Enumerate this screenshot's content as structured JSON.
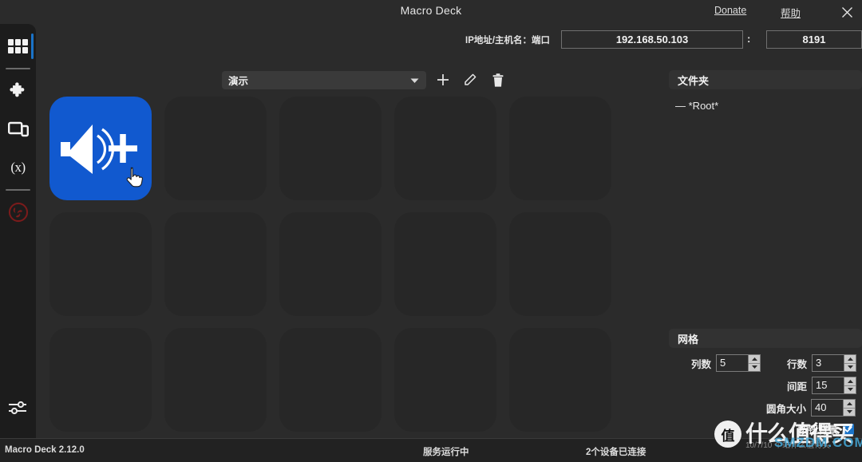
{
  "window": {
    "title": "Macro Deck",
    "donate_label": "Donate",
    "help_label": "帮助",
    "close_icon": "close-icon"
  },
  "connection": {
    "label": "IP地址/主机名：端口",
    "host_value": "192.168.50.103",
    "host_placeholder": "192.168.50.103",
    "separator": ":",
    "port_value": "8191",
    "port_placeholder": "8191"
  },
  "sidebar": {
    "items": [
      {
        "name": "sidebar-item-deck",
        "icon": "grid-icon",
        "active": true
      },
      {
        "name": "sidebar-item-plugins",
        "icon": "puzzle-icon",
        "active": false
      },
      {
        "name": "sidebar-item-devices",
        "icon": "device-icon",
        "active": false
      },
      {
        "name": "sidebar-item-variables",
        "icon": "variables-icon",
        "label": "(x)",
        "active": false
      },
      {
        "name": "sidebar-item-obs",
        "icon": "obs-icon",
        "active": false
      }
    ],
    "bottom_item": {
      "name": "sidebar-item-settings",
      "icon": "sliders-icon"
    }
  },
  "deck_toolbar": {
    "selected_profile": "演示",
    "dropdown_icon": "chevron-down-icon",
    "add_icon": "plus-icon",
    "edit_icon": "pencil-icon",
    "delete_icon": "trash-icon"
  },
  "deck_grid": {
    "columns": 5,
    "rows": 3,
    "buttons": [
      {
        "index": 0,
        "active": true,
        "icon": "volume-up-icon",
        "bg_color": "#1159cf"
      },
      {
        "index": 1,
        "active": false
      },
      {
        "index": 2,
        "active": false
      },
      {
        "index": 3,
        "active": false
      },
      {
        "index": 4,
        "active": false
      },
      {
        "index": 5,
        "active": false
      },
      {
        "index": 6,
        "active": false
      },
      {
        "index": 7,
        "active": false
      },
      {
        "index": 8,
        "active": false
      },
      {
        "index": 9,
        "active": false
      },
      {
        "index": 10,
        "active": false
      },
      {
        "index": 11,
        "active": false
      },
      {
        "index": 12,
        "active": false
      },
      {
        "index": 13,
        "active": false
      },
      {
        "index": 14,
        "active": false
      }
    ],
    "cursor_icon": "pointer-hand-cursor"
  },
  "folders_panel": {
    "header": "文件夹",
    "tree": [
      {
        "prefix": "—",
        "label": "*Root*"
      }
    ]
  },
  "grid_panel": {
    "header": "网格",
    "fields": [
      {
        "label": "列数",
        "value": "5",
        "name": "columns-spinner"
      },
      {
        "label": "行数",
        "value": "3",
        "name": "rows-spinner"
      },
      {
        "label": "间距",
        "value": "15",
        "name": "spacing-spinner"
      },
      {
        "label": "圆角大小",
        "value": "40",
        "name": "corner-radius-spinner"
      }
    ],
    "checkbox": {
      "label": "按钮背景",
      "checked": true
    }
  },
  "statusbar": {
    "version": "Macro Deck 2.12.0",
    "service": "服务运行中",
    "devices": "2个设备已连接"
  },
  "watermark": {
    "logo_char": "值",
    "text": "什么值得买",
    "sub": "SMZDM.COM",
    "date": "10/7/10 个站什么值得买"
  },
  "colors": {
    "accent_blue": "#1a73c8",
    "button_blue": "#1159cf",
    "window_bg": "#2b2b2b",
    "sidebar_bg": "#1c1c1c",
    "cell_bg": "#272727",
    "statusbar_bg": "#222222",
    "obs_red": "#7a1b1b"
  }
}
